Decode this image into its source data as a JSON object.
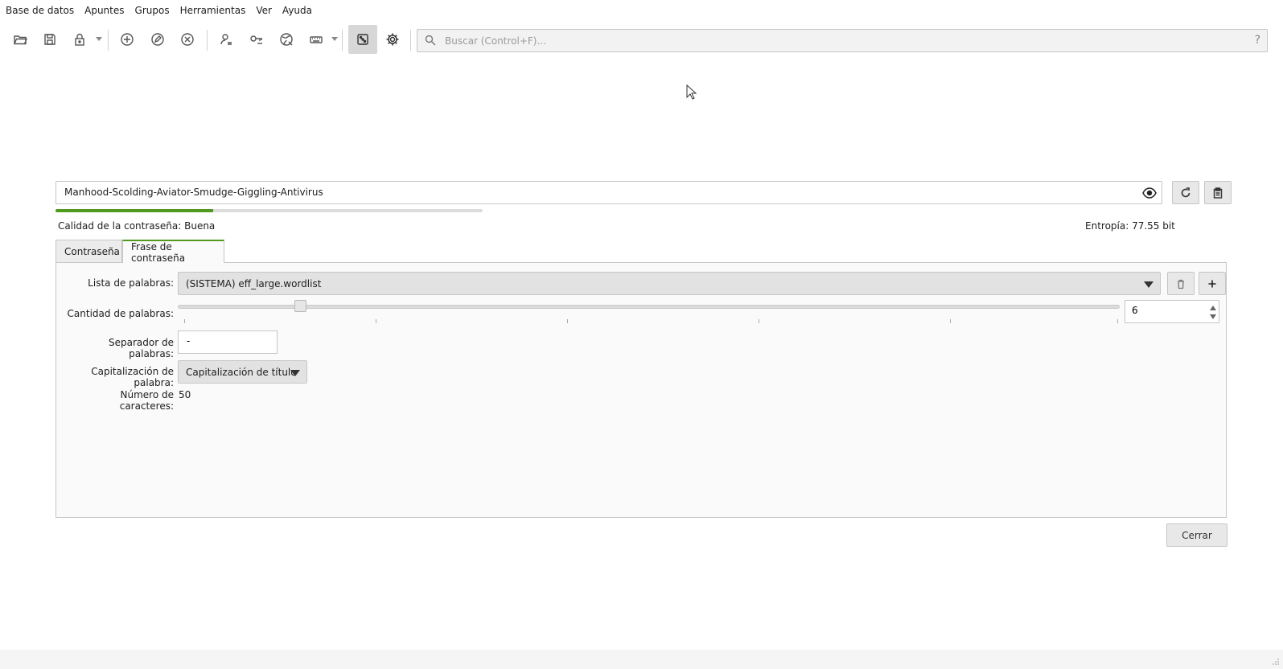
{
  "menu": [
    "Base de datos",
    "Apuntes",
    "Grupos",
    "Herramientas",
    "Ver",
    "Ayuda"
  ],
  "toolbar": {
    "icons": [
      "folder-open-icon",
      "save-icon",
      "lock-icon",
      "add-entry-icon",
      "edit-entry-icon",
      "delete-entry-icon",
      "copy-username-icon",
      "copy-password-icon",
      "open-url-icon",
      "autotype-icon",
      "password-generator-icon",
      "settings-icon"
    ],
    "active": "password-generator-icon"
  },
  "search": {
    "placeholder": "Buscar (Control+F)...",
    "help": "?"
  },
  "generator": {
    "password": "Manhood-Scolding-Aviator-Smudge-Giggling-Antivirus",
    "strength_fraction": 0.37,
    "strength_color": "#4f9a1f",
    "quality_label": "Calidad de la contraseña: Buena",
    "entropy_label": "Entropía: 77.55 bit"
  },
  "tabs": [
    {
      "label": "Contraseña",
      "selected": false
    },
    {
      "label": "Frase de contraseña",
      "selected": true
    }
  ],
  "form": {
    "wordlist_label": "Lista de palabras:",
    "wordlist_value": "(SISTEMA) eff_large.wordlist",
    "word_count_label": "Cantidad de palabras:",
    "word_count_value": "6",
    "word_count_slider_fraction": 0.13,
    "separator_label": "Separador de palabras:",
    "separator_value": "-",
    "capitalization_label": "Capitalización de palabra:",
    "capitalization_value": "Capitalización de título",
    "char_count_label": "Número de caracteres:",
    "char_count_value": "50"
  },
  "buttons": {
    "close": "Cerrar"
  }
}
